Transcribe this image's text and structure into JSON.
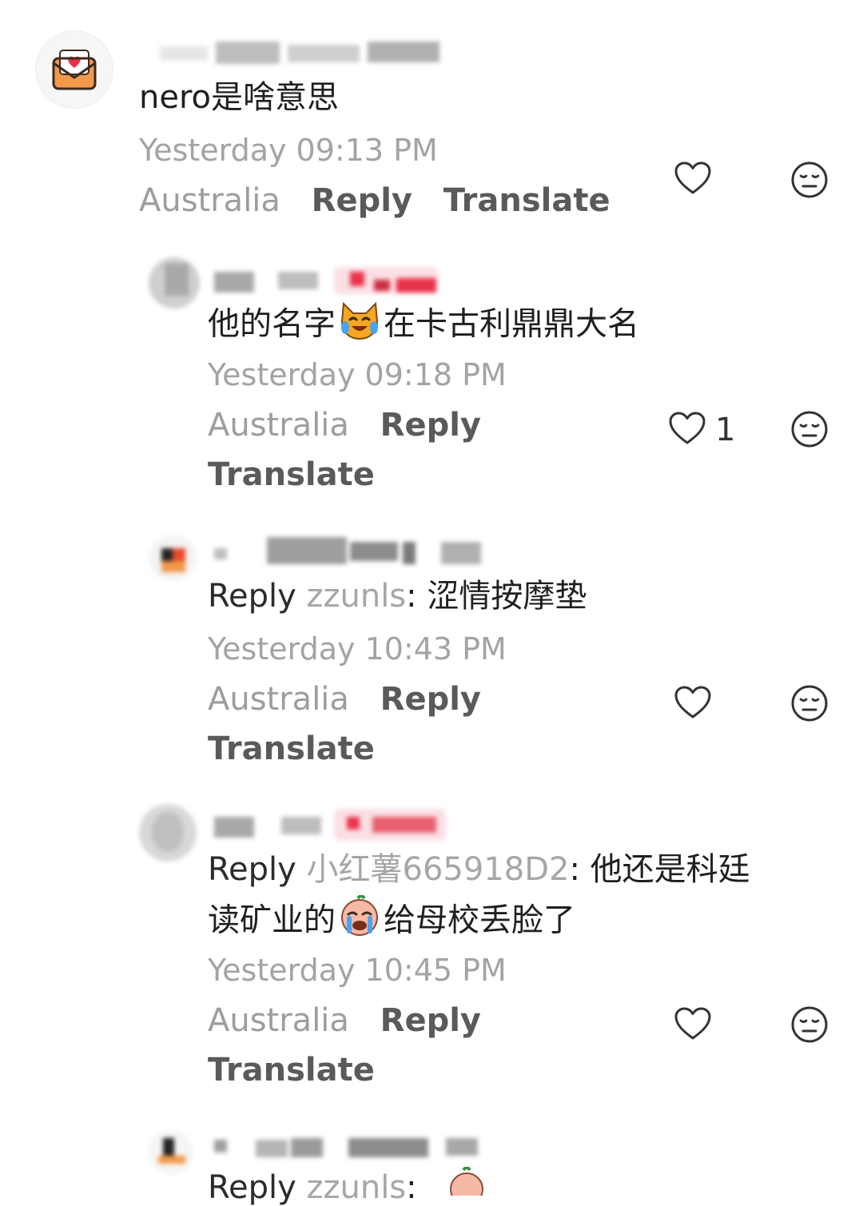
{
  "comments": [
    {
      "text": "nero是啥意思",
      "time": "Yesterday 09:13 PM",
      "location": "Australia",
      "reply_label": "Reply",
      "translate_label": "Translate",
      "like_count": ""
    },
    {
      "text_before": "他的名字",
      "text_after": "在卡古利鼎鼎大名",
      "emoji": "crying-laughing-cat-emoji",
      "time": "Yesterday 09:18 PM",
      "location": "Australia",
      "reply_label": "Reply",
      "translate_label": "Translate",
      "like_count": "1"
    },
    {
      "reply_prefix": "Reply",
      "reply_to": "zzunls",
      "text": ": 涩情按摩垫",
      "time": "Yesterday 10:43 PM",
      "location": "Australia",
      "reply_label": "Reply",
      "translate_label": "Translate",
      "like_count": ""
    },
    {
      "reply_prefix": "Reply",
      "reply_to": "小红薯665918D2",
      "text_line1": ": 他还是科廷",
      "text_line2_before": "读矿业的",
      "text_line2_after": "给母校丢脸了",
      "emoji": "crying-face-emoji",
      "time": "Yesterday 10:45 PM",
      "location": "Australia",
      "reply_label": "Reply",
      "translate_label": "Translate",
      "like_count": ""
    },
    {
      "reply_prefix": "Reply",
      "reply_to": "zzunls",
      "text": ":"
    }
  ],
  "colors": {
    "text_primary": "#1f1f1f",
    "text_secondary": "#a3a3a3",
    "action_bold": "#5a5a5a",
    "avatar_orange": "#f2994a",
    "badge_red": "#e8334a"
  },
  "icons": {
    "like": "heart-outline-icon",
    "dislike": "neutral-face-icon",
    "avatar1": "envelope-heart-icon"
  }
}
